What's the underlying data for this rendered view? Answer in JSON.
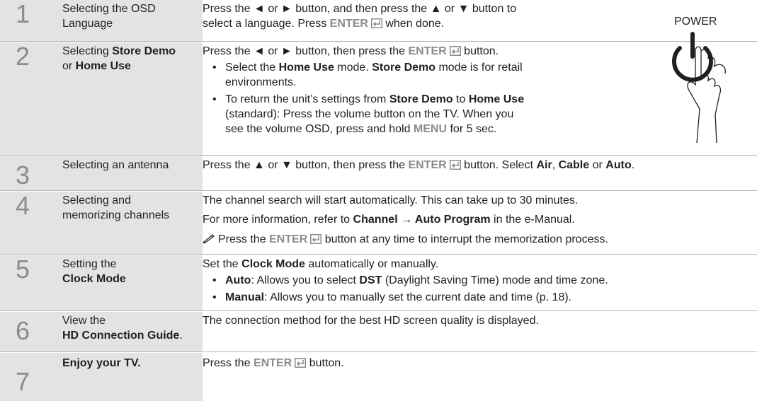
{
  "steps": [
    {
      "num": "1",
      "title": [
        "Selecting the OSD",
        "Language"
      ]
    },
    {
      "num": "2",
      "title_parts": [
        "Selecting ",
        "Store Demo",
        "or ",
        "Home Use"
      ]
    },
    {
      "num": "3",
      "title": [
        "Selecting an antenna"
      ]
    },
    {
      "num": "4",
      "title": [
        "Selecting and",
        "memorizing channels"
      ]
    },
    {
      "num": "5",
      "title_parts": [
        "Setting the",
        "Clock Mode"
      ]
    },
    {
      "num": "6",
      "title_parts": [
        "View the",
        "HD Connection Guide",
        "."
      ]
    },
    {
      "num": "7",
      "title": [
        "Enjoy your TV."
      ]
    }
  ],
  "desc": {
    "s1": [
      "Press the ◄ or ► button, and then press the ▲ or ▼ button to",
      "select a language. Press ",
      "ENTER",
      " when done."
    ],
    "s2": {
      "line": [
        "Press the ◄ or ► button, then press the ",
        "ENTER",
        " button."
      ],
      "b1": [
        "Select the ",
        "Home Use",
        " mode. ",
        "Store Demo",
        " mode is for retail",
        "environments."
      ],
      "b2": [
        "To return the unit’s settings from ",
        "Store Demo",
        " to ",
        "Home Use",
        "(standard): Press the volume button on the TV. When you",
        "see the volume OSD, press and hold ",
        "MENU",
        " for 5 sec."
      ]
    },
    "s3": [
      "Press the ▲ or ▼ button, then press the ",
      "ENTER",
      " button. Select ",
      "Air",
      ", ",
      "Cable",
      " or ",
      "Auto",
      "."
    ],
    "s4": {
      "l1": "The channel search will start automatically. This can take up to 30 minutes.",
      "l2": [
        "For more information, refer to ",
        "Channel → Auto Program",
        " in the e-Manual."
      ],
      "l3": [
        "Press the ",
        "ENTER",
        " button at any time to interrupt the memorization process."
      ]
    },
    "s5": {
      "line": [
        "Set the ",
        "Clock Mode",
        " automatically or manually."
      ],
      "b1": [
        "Auto",
        ": Allows you to select ",
        "DST",
        " (Daylight Saving Time) mode and time zone."
      ],
      "b2": [
        "Manual",
        ": Allows you to manually set the current date and time (p. 18)."
      ]
    },
    "s6": "The connection method for the best HD screen quality is displayed.",
    "s7": [
      "Press the ",
      "ENTER",
      " button."
    ]
  },
  "power": {
    "label": "POWER",
    "icon": "power-button-hand-icon"
  }
}
